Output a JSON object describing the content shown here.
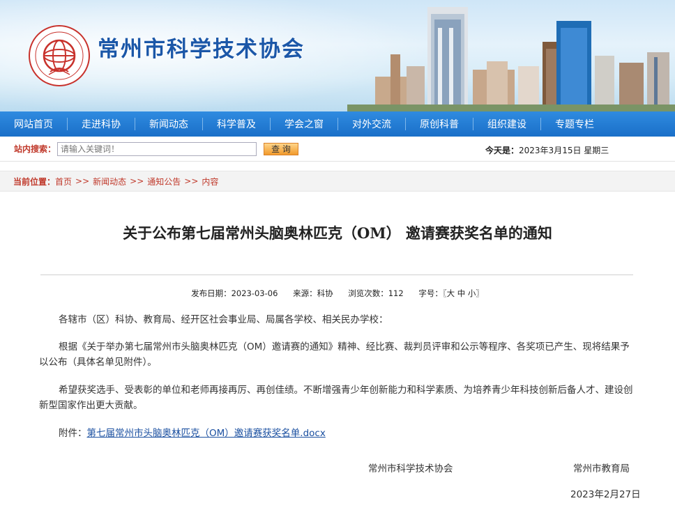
{
  "header": {
    "site_title": "常州市科学技术协会",
    "logo_text": "中国科学技术协会"
  },
  "nav": {
    "items": [
      "网站首页",
      "走进科协",
      "新闻动态",
      "科学普及",
      "学会之窗",
      "对外交流",
      "原创科普",
      "组织建设",
      "专题专栏"
    ]
  },
  "search": {
    "label": "站内搜索：",
    "placeholder": "请输入关键词！",
    "button": "查  询",
    "date_label": "今天是：",
    "date_value": "2023年3月15日  星期三"
  },
  "breadcrumb": {
    "label": "当前位置：",
    "items": [
      "首页",
      "新闻动态",
      "通知公告",
      "内容"
    ],
    "separator": ">>"
  },
  "article": {
    "title": "关于公布第七届常州头脑奥林匹克（OM） 邀请赛获奖名单的通知",
    "meta": {
      "publish": "发布日期：2023-03-06",
      "source": "来源：科协",
      "views": "浏览次数：112",
      "font_size": "字号：〖大  中  小〗"
    },
    "paragraphs": [
      "各辖市（区）科协、教育局、经开区社会事业局、局属各学校、相关民办学校：",
      "根据《关于举办第七届常州市头脑奥林匹克（OM）邀请赛的通知》精神、经比赛、裁判员评审和公示等程序、各奖项已产生、现将结果予以公布（具体名单见附件）。",
      "希望获奖选手、受表彰的单位和老师再接再厉、再创佳绩。不断增强青少年创新能力和科学素质、为培养青少年科技创新后备人才、建设创新型国家作出更大贡献。"
    ],
    "attachment_label": "附件：",
    "attachment_link": "第七届常州市头脑奥林匹克（OM）邀请赛获奖名单.docx",
    "signer1": "常州市科学技术协会",
    "signer2": "常州市教育局",
    "sign_date": "2023年2月27日"
  }
}
